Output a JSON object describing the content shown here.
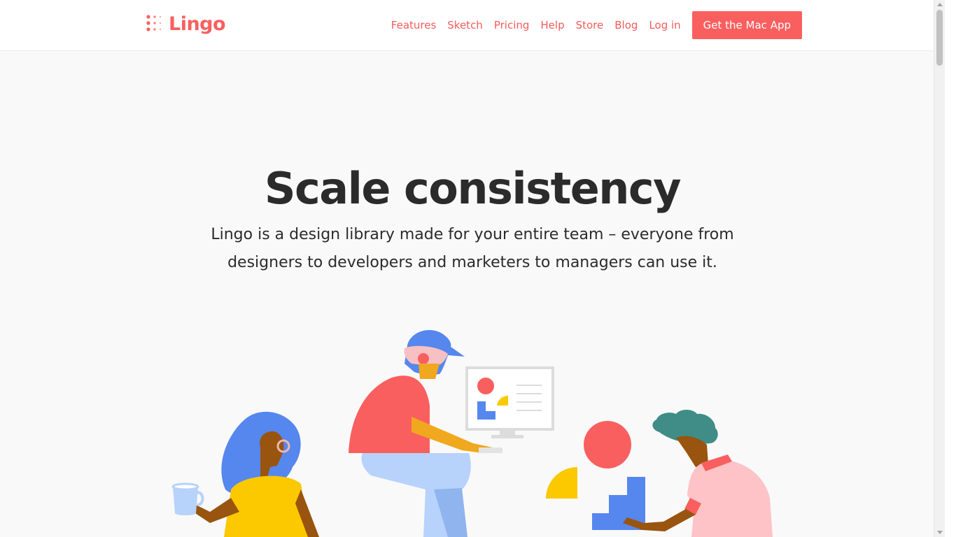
{
  "header": {
    "logo_text": "Lingo",
    "nav": [
      {
        "label": "Features"
      },
      {
        "label": "Sketch"
      },
      {
        "label": "Pricing"
      },
      {
        "label": "Help"
      },
      {
        "label": "Store"
      },
      {
        "label": "Blog"
      },
      {
        "label": "Log in"
      }
    ],
    "cta_label": "Get the Mac App"
  },
  "hero": {
    "title": "Scale consistency",
    "subtitle": "Lingo is a design library made for your entire team – everyone from designers to developers and marketers to managers can use it."
  },
  "colors": {
    "accent": "#fa5f5f",
    "text": "#2b2b2b",
    "background": "#f9f9f9"
  }
}
